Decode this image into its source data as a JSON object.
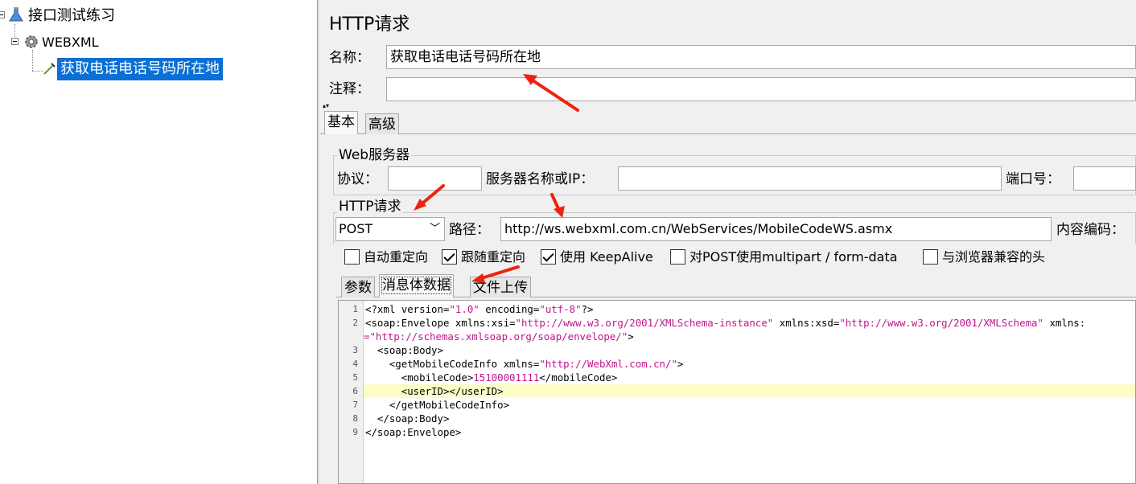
{
  "tree": {
    "root": "接口测试练习",
    "group": "WEBXML",
    "sampler": "获取电话电话号码所在地"
  },
  "sampler": {
    "panel_title": "HTTP请求",
    "name_label": "名称：",
    "name_value": "获取电话电话号码所在地",
    "comment_label": "注释：",
    "comment_value": ""
  },
  "tabs": {
    "basic": "基本",
    "advanced": "高级"
  },
  "web_server": {
    "legend": "Web服务器",
    "protocol_label": "协议：",
    "protocol_value": "",
    "server_label": "服务器名称或IP：",
    "server_value": "",
    "port_label": "端口号：",
    "port_value": ""
  },
  "http_request": {
    "legend": "HTTP请求",
    "method": "POST",
    "path_label": "路径：",
    "path_value": "http://ws.webxml.com.cn/WebServices/MobileCodeWS.asmx",
    "encoding_label": "内容编码："
  },
  "options": [
    {
      "label": "自动重定向",
      "checked": false
    },
    {
      "label": "跟随重定向",
      "checked": true
    },
    {
      "label": "使用 KeepAlive",
      "checked": true
    },
    {
      "label": "对POST使用multipart / form-data",
      "checked": false
    },
    {
      "label": "与浏览器兼容的头",
      "checked": false
    }
  ],
  "body_tabs": {
    "params": "参数",
    "body_data": "消息体数据",
    "files": "文件上传"
  },
  "editor": {
    "line_numbers": [
      "1",
      "2",
      "",
      "3",
      "4",
      "5",
      "6",
      "7",
      "8",
      "9"
    ],
    "lines": {
      "l1a": "<?xml version=",
      "l1b": "\"1.0\"",
      "l1c": " encoding=",
      "l1d": "\"utf-8\"",
      "l1e": "?>",
      "l2a": "<soap:Envelope xmlns:xsi=",
      "l2b": "\"http://www.w3.org/2001/XMLSchema-instance\"",
      "l2c": " xmlns:xsd=",
      "l2d": "\"http://www.w3.org/2001/XMLSchema\"",
      "l2e": " xmlns:",
      "l2f": "=\"http://schemas.xmlsoap.org/soap/envelope/\"",
      "l2g": ">",
      "l3": "  <soap:Body>",
      "l4a": "    <getMobileCodeInfo xmlns=",
      "l4b": "\"http://WebXml.com.cn/\"",
      "l4c": ">",
      "l5a": "      <mobileCode>",
      "l5b": "15100001111",
      "l5c": "</mobileCode>",
      "l6": "      <userID></userID>",
      "l7": "    </getMobileCodeInfo>",
      "l8": "  </soap:Body>",
      "l9": "</soap:Envelope>"
    }
  },
  "colors": {
    "selection": "#0a6fd6",
    "string": "#c0158c",
    "annotation_arrow": "#ee2211",
    "highlight_line": "#fdfdc8"
  }
}
